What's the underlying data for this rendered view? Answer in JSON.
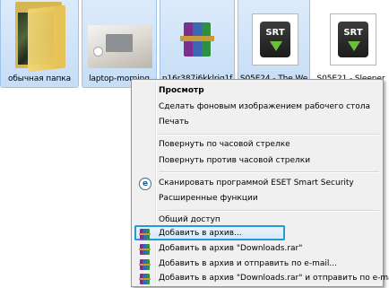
{
  "files": [
    {
      "name": "обычная папка",
      "icon": "folder-icon"
    },
    {
      "name": "laptop-morning",
      "icon": "image-thumbnail-icon"
    },
    {
      "name": "p16r387i6kklrig1f",
      "icon": "winrar-archive-icon"
    },
    {
      "name": "S05E24 - The We",
      "icon": "srt-file-icon"
    },
    {
      "name": "S05E21 - Sleeper",
      "icon": "srt-file-icon"
    }
  ],
  "context_menu": {
    "items": [
      {
        "label": "Просмотр",
        "bold": true
      },
      {
        "label": "Сделать фоновым изображением рабочего стола"
      },
      {
        "label": "Печать"
      },
      {
        "label": "Повернуть по часовой стрелке"
      },
      {
        "label": "Повернуть против часовой стрелки"
      },
      {
        "label": "Сканировать программой ESET Smart Security",
        "icon": "eset-icon"
      },
      {
        "label": "Расширенные функции"
      },
      {
        "label": "Общий доступ"
      },
      {
        "label": "Добавить в архив...",
        "icon": "winrar-icon"
      },
      {
        "label": "Добавить в архив \"Downloads.rar\"",
        "icon": "winrar-icon"
      },
      {
        "label": "Добавить в архив и отправить по e-mail...",
        "icon": "winrar-icon"
      },
      {
        "label": "Добавить в архив \"Downloads.rar\" и отправить по e-mail",
        "icon": "winrar-icon"
      }
    ],
    "highlight_color": "#1f9bd6",
    "eset_glyph": "e"
  }
}
